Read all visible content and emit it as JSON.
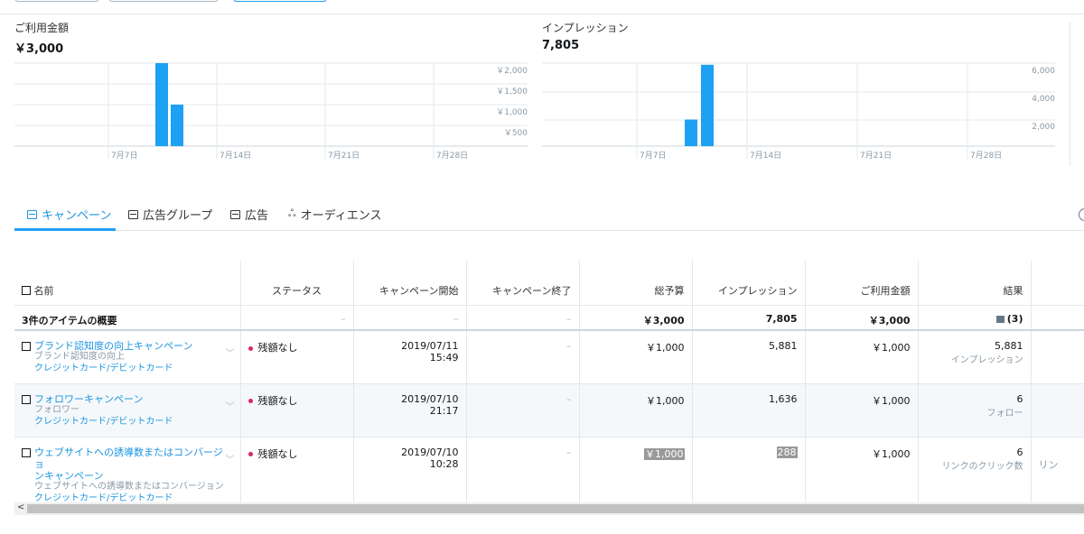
{
  "colors": {
    "accent": "#1da1f2",
    "link": "#1b95e0",
    "status_dot": "#e0245e"
  },
  "charts": {
    "spend": {
      "title": "ご利用金額",
      "total": "￥3,000",
      "x_ticks": [
        "7月7日",
        "7月14日",
        "7月21日",
        "7月28日"
      ],
      "y_ticks": [
        "￥2,000",
        "￥1,500",
        "￥1,000",
        "￥500"
      ]
    },
    "impressions": {
      "title": "インプレッション",
      "total": "7,805",
      "x_ticks": [
        "7月7日",
        "7月14日",
        "7月21日",
        "7月28日"
      ],
      "y_ticks": [
        "6,000",
        "4,000",
        "2,000"
      ]
    }
  },
  "chart_data": [
    {
      "type": "bar",
      "title": "ご利用金額",
      "x": [
        "7月10日",
        "7月11日"
      ],
      "values": [
        2000,
        1000
      ],
      "ylim": [
        0,
        2000
      ],
      "xlabel": "",
      "ylabel": ""
    },
    {
      "type": "bar",
      "title": "インプレッション",
      "x": [
        "7月10日",
        "7月11日"
      ],
      "values": [
        1924,
        5881
      ],
      "ylim": [
        0,
        6000
      ],
      "xlabel": "",
      "ylabel": ""
    }
  ],
  "tabs": [
    {
      "label": "キャンペーン",
      "icon": "list-icon",
      "active": true
    },
    {
      "label": "広告グループ",
      "icon": "stack-icon",
      "active": false
    },
    {
      "label": "広告",
      "icon": "card-icon",
      "active": false
    },
    {
      "label": "オーディエンス",
      "icon": "people-icon",
      "active": false
    }
  ],
  "table": {
    "headers": {
      "name": "名前",
      "status": "ステータス",
      "start": "キャンペーン開始",
      "end": "キャンペーン終了",
      "budget": "総予算",
      "impressions": "インプレッション",
      "spend": "ご利用金額",
      "results": "結果"
    },
    "summary": {
      "label": "3件のアイテムの概要",
      "status": "–",
      "start": "–",
      "end": "–",
      "budget": "￥3,000",
      "impressions": "7,805",
      "spend": "￥3,000",
      "results": "(3)"
    },
    "rows": [
      {
        "name": "ブランド認知度の向上キャンペーン",
        "objective": "ブランド認知度の向上",
        "payment": "クレジットカード/デビットカード",
        "status": "残額なし",
        "start_date": "2019/07/11",
        "start_time": "15:49",
        "end": "–",
        "budget": "￥1,000",
        "impressions": "5,881",
        "spend": "￥1,000",
        "result_value": "5,881",
        "result_type": "インプレッション"
      },
      {
        "name": "フォロワーキャンペーン",
        "objective": "フォロワー",
        "payment": "クレジットカード/デビットカード",
        "status": "残額なし",
        "start_date": "2019/07/10",
        "start_time": "21:17",
        "end": "–",
        "budget": "￥1,000",
        "impressions": "1,636",
        "spend": "￥1,000",
        "result_value": "6",
        "result_type": "フォロー"
      },
      {
        "name_line1": "ウェブサイトへの誘導数またはコンバージョ",
        "name_line2": "ンキャンペーン",
        "objective": "ウェブサイトへの誘導数またはコンバージョン",
        "payment": "クレジットカード/デビットカード",
        "status": "残額なし",
        "start_date": "2019/07/10",
        "start_time": "10:28",
        "end": "–",
        "budget": "￥1,000",
        "impressions": "288",
        "spend": "￥1,000",
        "result_value": "6",
        "result_type": "リンクのクリック数",
        "overflow_text": "リン"
      }
    ]
  }
}
